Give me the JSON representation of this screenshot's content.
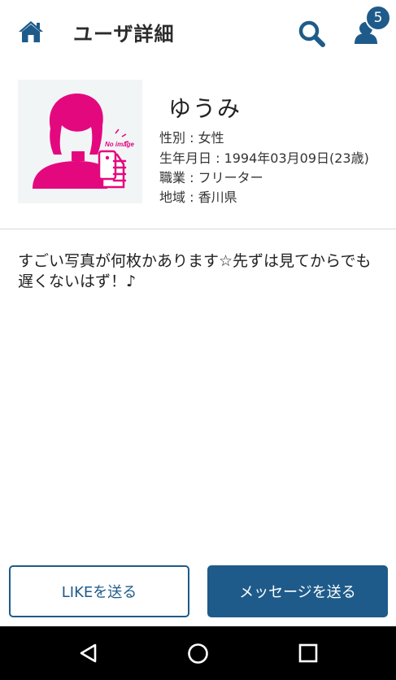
{
  "header": {
    "title": "ユーザ詳細",
    "badge_count": "5",
    "icons": {
      "home": "home-icon",
      "search": "search-icon",
      "users": "user-icon"
    },
    "accent": "#1e5b8a"
  },
  "profile": {
    "name": "ゆうみ",
    "avatar_label": "No image",
    "gender": "性別 : 女性",
    "birthday": "生年月日 : 1994年03月09日(23歳)",
    "job": "職業 : フリーター",
    "area": "地域 : 香川県"
  },
  "bio": "すごい写真が何枚かあります☆先ずは見てからでも遅くないはず！♪",
  "actions": {
    "like_label": "LIKEを送る",
    "message_label": "メッセージを送る"
  },
  "navbar": {
    "icons": {
      "back": "back-icon",
      "home": "home-circle-icon",
      "recent": "recent-apps-icon"
    }
  }
}
